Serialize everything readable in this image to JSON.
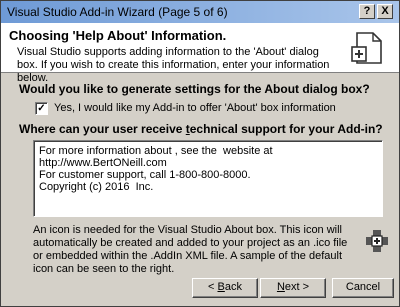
{
  "window": {
    "title": "Visual Studio Add-in Wizard (Page 5 of 6)",
    "help_glyph": "?",
    "close_glyph": "X"
  },
  "header": {
    "title": "Choosing 'Help About' Information.",
    "description": "Visual Studio supports adding information to the 'About' dialog box. If you wish to create this information, enter your information below.",
    "icon": "about-box-icon"
  },
  "about_section": {
    "question": "Would you like to generate settings for the About dialog box?",
    "checkbox_label": "Yes, I would like my Add-in to offer 'About' box information",
    "checked": true
  },
  "support_section": {
    "question_before": "Where can your user receive ",
    "question_underlined": "t",
    "question_after": "echnical support for your Add-in?",
    "text": "For more information about , see the  website at\nhttp://www.BertONeill.com\nFor customer support, call 1-800-800-8000.\nCopyright (c) 2016  Inc."
  },
  "info": {
    "text": "An icon is needed for the Visual Studio About box. This icon will automatically be created and added to your project as an .ico file or embedded within the .AddIn XML file. A sample of the default icon can be seen to the right.",
    "icon": "addin-default-icon"
  },
  "buttons": {
    "back_pre": "< ",
    "back_u": "B",
    "back_post": "ack",
    "next_u": "N",
    "next_post": "ext >",
    "cancel": "Cancel"
  }
}
